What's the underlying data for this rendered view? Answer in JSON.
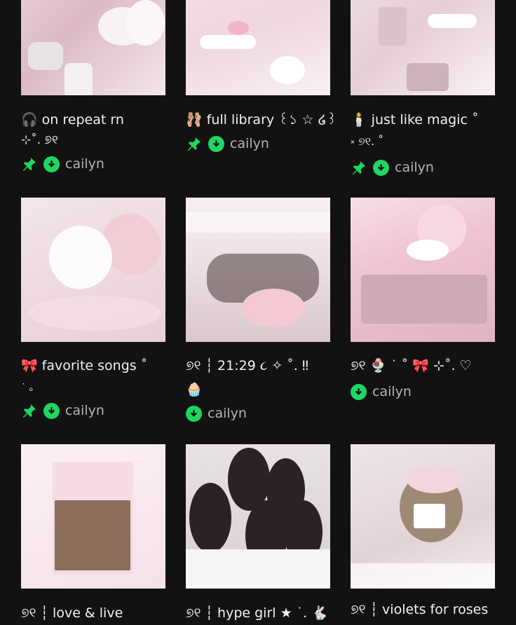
{
  "colors": {
    "background": "#121212",
    "accent_green": "#1ed760",
    "text": "#f2f2f2",
    "secondary_text": "#b3b3b3"
  },
  "playlists": [
    {
      "title_line1": "on repeat rn",
      "title_line2": "⊹˚. ୭୧",
      "emoji": "🎧",
      "owner": "cailyn",
      "pinned": true,
      "downloaded": true,
      "cover_icon": "pink-knit-bears-icon"
    },
    {
      "title_line1": "full library ꒰১ ☆ ໒꒱",
      "title_line2": "",
      "emoji": "🩰",
      "owner": "cailyn",
      "pinned": true,
      "downloaded": true,
      "cover_icon": "pearls-and-bows-icon"
    },
    {
      "title_line1": "just like magic ˚",
      "title_line2": "༝ ୭୧. ˚",
      "emoji": "🕯️",
      "owner": "cailyn",
      "pinned": true,
      "downloaded": true,
      "cover_icon": "photocard-collage-icon"
    },
    {
      "title_line1": "favorite songs ˚",
      "title_line2": "˙ ₒ",
      "emoji": "🎀",
      "owner": "cailyn",
      "pinned": true,
      "downloaded": true,
      "cover_icon": "white-roses-icon"
    },
    {
      "title_line1": "୭୧ ┆ 21:29 ૮ ✧ ˚. ‼",
      "title_line2": "",
      "emoji": "🧁",
      "owner": "cailyn",
      "pinned": false,
      "downloaded": true,
      "cover_icon": "group-photo-cake-icon"
    },
    {
      "title_line1": "୭୧ 🍨 ˙ ˚ 🎀 ⊹˚. ♡",
      "title_line2": "",
      "emoji": "",
      "owner": "cailyn",
      "pinned": false,
      "downloaded": true,
      "cover_icon": "pink-desk-shelf-icon"
    },
    {
      "title_line1": "୭୧ ┆ love & live",
      "title_line2": "",
      "emoji": "",
      "owner": "",
      "pinned": false,
      "downloaded": false,
      "cover_icon": "album-cover-icon"
    },
    {
      "title_line1": "୭୧ ┆ hype girl ★ ˙. 🐇",
      "title_line2": "",
      "emoji": "",
      "owner": "",
      "pinned": false,
      "downloaded": false,
      "cover_icon": "girl-group-selfie-icon"
    },
    {
      "title_line1": "୭୧ ┆ violets for roses",
      "title_line2": "",
      "emoji": "",
      "owner": "",
      "pinned": false,
      "downloaded": false,
      "cover_icon": "teddy-bear-headphones-icon"
    }
  ]
}
